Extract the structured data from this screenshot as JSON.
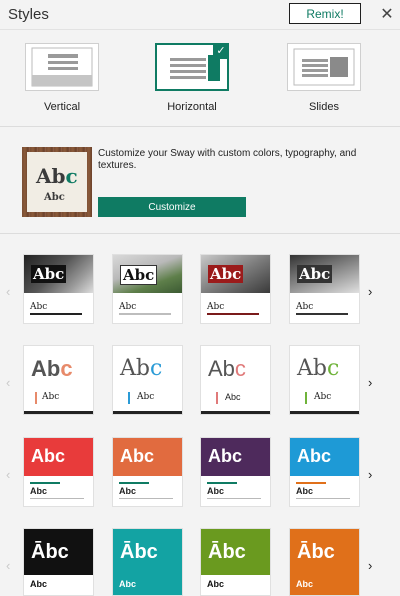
{
  "header": {
    "title": "Styles",
    "remix_label": "Remix!",
    "close_glyph": "✕"
  },
  "layouts": {
    "items": [
      {
        "label": "Vertical",
        "icon": "vertical-layout-icon"
      },
      {
        "label": "Horizontal",
        "icon": "horizontal-layout-icon",
        "selected": true
      },
      {
        "label": "Slides",
        "icon": "slides-layout-icon"
      }
    ],
    "check_glyph": "✓"
  },
  "customize": {
    "preview_big": "Ab",
    "preview_big_accent": "c",
    "preview_small": "Abc",
    "description": "Customize your Sway with custom colors, typography, and textures.",
    "button_label": "Customize"
  },
  "navigation": {
    "prev_glyph": "‹",
    "next_glyph": "›"
  },
  "style_rows": [
    {
      "cards": [
        {
          "big": "Abc",
          "small": "Abc",
          "theme": "photo-dark"
        },
        {
          "big": "Abc",
          "small": "Abc",
          "theme": "photo-mountain"
        },
        {
          "big": "Abc",
          "small": "Abc",
          "theme": "photo-red"
        },
        {
          "big": "Abc",
          "small": "Abc",
          "theme": "photo-gray"
        }
      ]
    },
    {
      "cards": [
        {
          "big": "Ab",
          "big_accent": "c",
          "small": "Abc",
          "accent": "#e78a6a"
        },
        {
          "big": "Ab",
          "big_accent": "c",
          "small": "Abc",
          "accent": "#2b9bd6"
        },
        {
          "big": "Ab",
          "big_accent": "c",
          "small": "Abc",
          "accent": "#e07a7a"
        },
        {
          "big": "Ab",
          "big_accent": "c",
          "small": "Abc",
          "accent": "#6fb33a"
        }
      ]
    },
    {
      "cards": [
        {
          "big": "Abc",
          "small": "Abc",
          "color": "#e83b3b"
        },
        {
          "big": "Abc",
          "small": "Abc",
          "color": "#e16b3f"
        },
        {
          "big": "Abc",
          "small": "Abc",
          "color": "#4e2a5c"
        },
        {
          "big": "Abc",
          "small": "Abc",
          "color": "#1e9ad6"
        }
      ]
    },
    {
      "cards": [
        {
          "big": "Ābc",
          "small": "Abc",
          "color": "#111111"
        },
        {
          "big": "Ābc",
          "small": "Abc",
          "color": "#13a3a3"
        },
        {
          "big": "Ābc",
          "small": "Abc",
          "color": "#6a9a1f"
        },
        {
          "big": "Ābc",
          "small": "Abc",
          "color": "#e0701a"
        }
      ]
    }
  ],
  "colors": {
    "accent": "#0f7b63",
    "background": "#f3f3f3"
  }
}
